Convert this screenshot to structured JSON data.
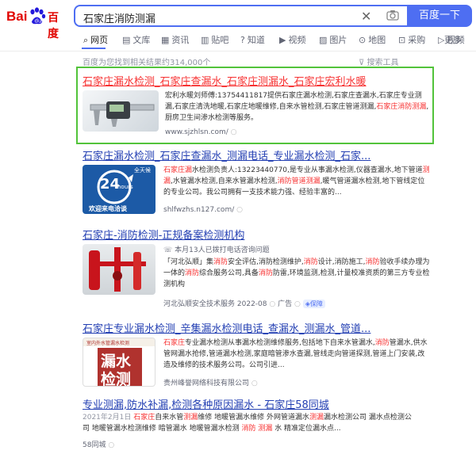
{
  "header": {
    "logo_text_left": "Bai",
    "logo_text_right": "百度",
    "search_value": "石家庄消防测漏",
    "search_button": "百度一下"
  },
  "tabs": [
    {
      "icon": "⌕",
      "label": "网页",
      "active": true
    },
    {
      "icon": "▤",
      "label": "文库"
    },
    {
      "icon": "▦",
      "label": "资讯"
    },
    {
      "icon": "▥",
      "label": "贴吧"
    },
    {
      "icon": "?",
      "label": "知道"
    },
    {
      "icon": "▶",
      "label": "视频"
    },
    {
      "icon": "▨",
      "label": "图片"
    },
    {
      "icon": "⊙",
      "label": "地图"
    },
    {
      "icon": "⊡",
      "label": "采购"
    },
    {
      "icon": "▷",
      "label": "视频"
    },
    {
      "label": "更多"
    }
  ],
  "result_count": "百度为您找到相关结果约314,000个",
  "tools_label": "搜索工具",
  "results": [
    {
      "title_parts": [
        "石家庄漏水检测_石家庄查漏水_石家庄测漏水_石家庄宏利水暖"
      ],
      "desc": "宏利水暖刘师傅:13754411817提供石家庄漏水检测,石家庄查漏水,石家庄专业测漏,石家庄清洗地暖,石家庄地暖维修,自来水管检测,石家庄管道测漏,",
      "desc_red": "石家庄消防测漏",
      "desc_end": ",厨房卫生间渗水检测等服务。",
      "url": "www.sjzhlsn.com/"
    },
    {
      "title": "石家庄漏水检测_石家庄查漏水_测漏电话_专业漏水检测_石家...",
      "desc_red1": "石家庄漏",
      "desc1": "水检测负责人:13223440770,是专业从事漏水检测,仪器查漏水,地下管道",
      "desc_red2": "测漏",
      "desc2": ",水管漏水检测,自来水管漏水检测,",
      "desc_red3": "消防管道测漏",
      "desc3": ",暖气管道漏水检测,地下管线定位的专业公司。我公司拥有一支技术能力强、经验丰富的...",
      "url": "shlfwzhs.n127.com/",
      "thumb_big": "24",
      "thumb_sub": "hours",
      "thumb_top": "全天候",
      "thumb_bottom": "欢迎来电洽谈"
    },
    {
      "title": "石家庄-消防检测-正规备案检测机构",
      "note": "本月13人已拨打电话咨询问题",
      "desc1": "「河北弘顺」集",
      "desc_red1": "消防",
      "desc2": "安全评估,消防检测维护,",
      "desc_red2": "消防",
      "desc3": "设计,消防施工,",
      "desc_red3": "消防",
      "desc4": "验收手续办理为一体的",
      "desc_red4": "消防",
      "desc5": "综合服务公司,具备",
      "desc_red5": "消防",
      "desc6": "防雷,环境监测,检测,计量校准资质的第三方专业检测机构",
      "source": "河北弘顺安全技术服务",
      "date": "2022-08",
      "ad": "广告",
      "badge": "保障"
    },
    {
      "title": "石家庄专业漏水检测_辛集漏水检测电话_查漏水_测漏水_管道...",
      "desc_red1": "石家庄",
      "desc1": "专业漏水检测从事漏水检测维修服务,包括地下自来水管漏水,",
      "desc_red2": "消防",
      "desc2": "管漏水,供水管网漏水抢修,管道漏水检测,家庭暗管渗水查漏,管线走向管道探测,管道上门安装,改造及维修的技术服务公司。公司引进...",
      "source": "贵州峰誉网络科技有限公司",
      "thumb_line1": "漏水",
      "thumb_line2": "检测",
      "thumb_tag": "室内外水管漏水检测"
    },
    {
      "title": "专业测漏,防水补漏,检测各种原因漏水 - 石家庄58同城",
      "date": "2021年2月1日",
      "desc_red1": "石家庄",
      "desc1": "自来水管",
      "desc_red2": "测漏",
      "desc2": "维修 地暖管漏水维修 外网管道漏水",
      "desc_red3": "测漏",
      "desc3": "漏水检测公司 漏水点检测公司 地暖管漏水检测维修 暗管漏水 地暖管漏水检测 ",
      "desc_red4": "消防 测漏",
      "desc4": " 水 精准定位漏水点...",
      "url": "58同城"
    }
  ]
}
